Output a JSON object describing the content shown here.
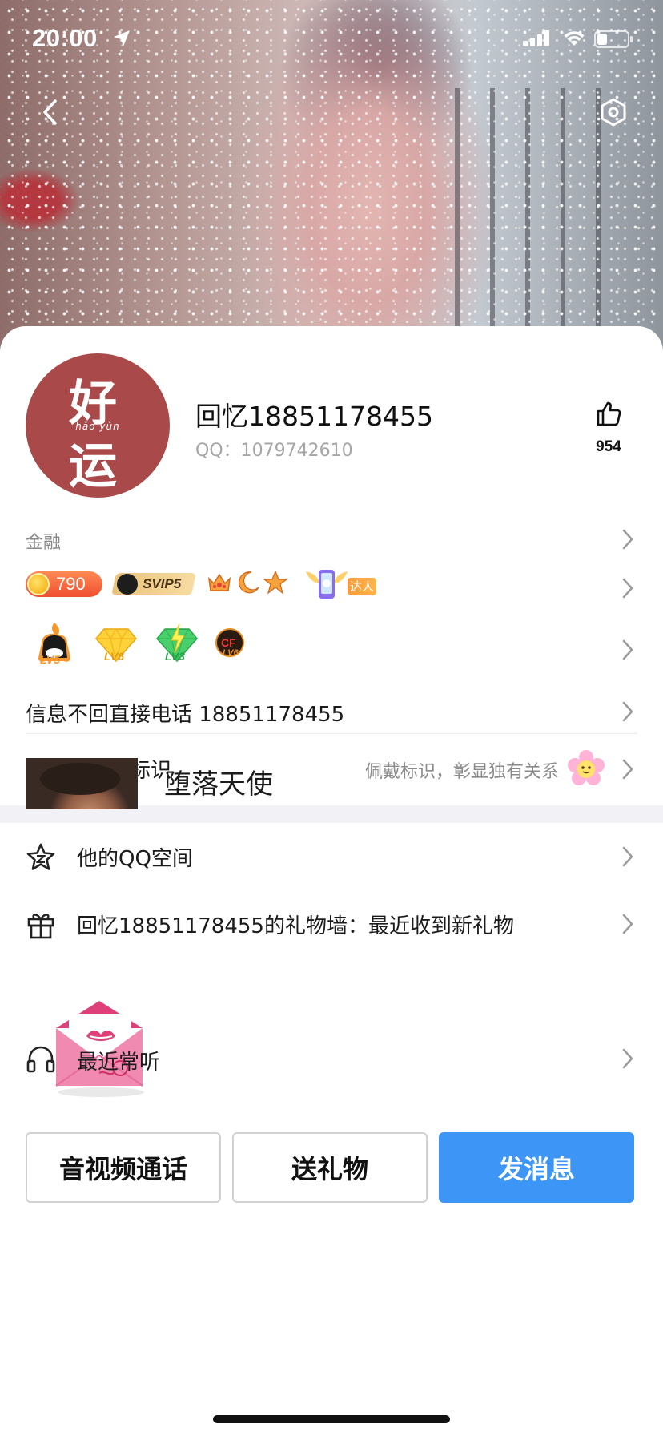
{
  "status_bar": {
    "time": "20:00",
    "icons": [
      "location-arrow-icon",
      "signal-icon",
      "wifi-icon",
      "battery-icon"
    ]
  },
  "header": {
    "back_icon": "chevron-left-icon",
    "settings_icon": "hexagon-settings-icon"
  },
  "profile": {
    "avatar": {
      "char_top": "好",
      "pinyin": "hǎo yùn",
      "char_bottom": "运",
      "color": "#a9494a"
    },
    "nickname": "回忆18851178455",
    "qq_number": "QQ：1079742610",
    "likes": "954",
    "industry": "金融"
  },
  "badges": {
    "coin_value": "790",
    "svip_label": "SVIP5",
    "daren_label": "达人",
    "levels": [
      {
        "name": "penguin-lv",
        "label": "LV5"
      },
      {
        "name": "diamond-yellow-lv",
        "label": "LV6"
      },
      {
        "name": "diamond-green-lv",
        "label": "LV3"
      },
      {
        "name": "game-cf-lv",
        "label": "LV6"
      }
    ]
  },
  "rows": {
    "signature": "信息不回直接电话 18851178455",
    "interaction_label": "你们的互动标识",
    "interaction_hint": "佩戴标识，彰显独有关系"
  },
  "menu": {
    "qzone": "他的QQ空间",
    "gift_wall": "回忆18851178455的礼物墙：最近收到新礼物",
    "recent_music": "最近常听",
    "song_title": "堕落天使"
  },
  "actions": {
    "call": "音视频通话",
    "gift": "送礼物",
    "message": "发消息"
  },
  "colors": {
    "primary": "#3d96f6",
    "section_gap": "#f2f2f6",
    "secondary_text": "#8a8a8a"
  }
}
